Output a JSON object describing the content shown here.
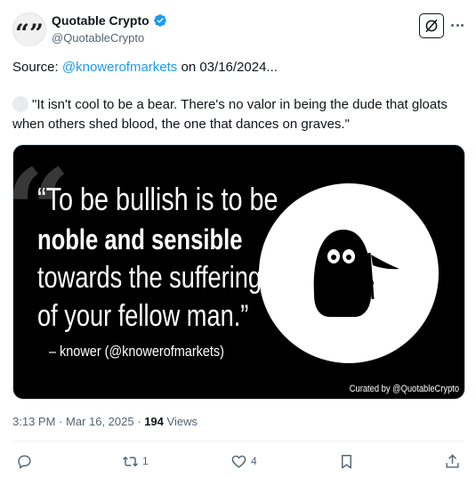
{
  "author": {
    "name": "Quotable Crypto",
    "handle": "@QuotableCrypto",
    "avatar_glyph": "“”",
    "verified": true,
    "verified_color": "#1d9bf0"
  },
  "header_icons": [
    "grok-icon",
    "more-icon"
  ],
  "body": {
    "source_prefix": "Source:",
    "source_mention": "@knowerofmarkets",
    "source_suffix": "on 03/16/2024...",
    "quote_text": "\"It isn't cool to be a bear. There's no valor in being the dude that gloats when others shed blood, the one that dances on graves.\""
  },
  "media": {
    "line1": "“To be bullish is to be",
    "line2": "noble and sensible",
    "line3": "towards the suffering",
    "line4": "of your fellow man.”",
    "attribution": "– knower (@knowerofmarkets)",
    "curated": "Curated by @QuotableCrypto"
  },
  "meta": {
    "time": "3:13 PM",
    "date": "Mar 16, 2025",
    "views_count": "194",
    "views_label": "Views"
  },
  "actions": {
    "reply_count": "",
    "retweet_count": "1",
    "like_count": "4"
  },
  "colors": {
    "accent": "#1d9bf0",
    "secondary_text": "#536471",
    "primary_text": "#0f1419"
  }
}
